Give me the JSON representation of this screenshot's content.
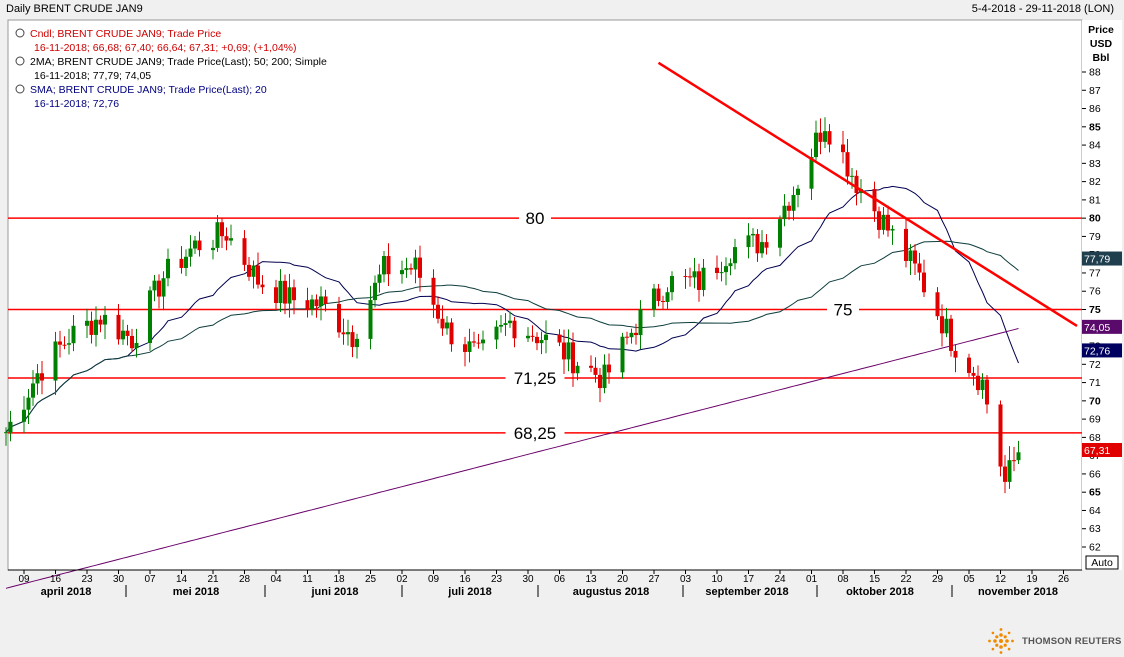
{
  "header": {
    "title": "Daily BRENT CRUDE JAN9",
    "range": "5-4-2018 - 29-11-2018 (LON)"
  },
  "axis_units": [
    "Price",
    "USD",
    "Bbl"
  ],
  "auto_label": "Auto",
  "legend": [
    {
      "line1": "Cndl; BRENT CRUDE JAN9; Trade Price",
      "line2": "16-11-2018; 66,68; 67,40; 66,64; 67,31; +0,69; (+1,04%)",
      "color": "#d00000"
    },
    {
      "line1": "2MA; BRENT CRUDE JAN9; Trade Price(Last); 50; 200; Simple",
      "line2": "16-11-2018; 77,79; 74,05",
      "color": "#000000"
    },
    {
      "line1": "SMA; BRENT CRUDE JAN9; Trade Price(Last); 20",
      "line2": "16-11-2018; 72,76",
      "color": "#000080"
    }
  ],
  "brand": "THOMSON REUTERS",
  "colors": {
    "up": "#008000",
    "down": "#e00000",
    "level": "#ff0000",
    "ma50": "#0d3d3d",
    "ma200": "#6a006a",
    "sma20": "#000050"
  },
  "chart_data": {
    "type": "candlestick",
    "y_range": [
      61,
      89
    ],
    "y_ticks": [
      62,
      63,
      64,
      65,
      66,
      67,
      68,
      69,
      70,
      71,
      72,
      73,
      74,
      75,
      76,
      77,
      78,
      79,
      80,
      81,
      82,
      83,
      84,
      85,
      86,
      87,
      88
    ],
    "y_bold_ticks": [
      65,
      70,
      75,
      80,
      85
    ],
    "x_day_ticks": [
      "09",
      "16",
      "23",
      "30",
      "07",
      "14",
      "21",
      "28",
      "04",
      "11",
      "18",
      "25",
      "02",
      "09",
      "16",
      "23",
      "30",
      "06",
      "13",
      "20",
      "27",
      "03",
      "10",
      "17",
      "24",
      "01",
      "08",
      "15",
      "22",
      "29",
      "05",
      "12",
      "19",
      "26"
    ],
    "months": [
      "april 2018",
      "mei 2018",
      "juni 2018",
      "juli 2018",
      "augustus 2018",
      "september 2018",
      "oktober 2018",
      "november 2018"
    ],
    "levels": [
      {
        "value": 80,
        "label": "80"
      },
      {
        "value": 75,
        "label": "75"
      },
      {
        "value": 71.25,
        "label": "71,25"
      },
      {
        "value": 68.25,
        "label": "68,25"
      }
    ],
    "trendline": {
      "start": [
        "2018-08-28",
        88.5
      ],
      "end": [
        "2018-11-29",
        74.1
      ]
    },
    "last_values": [
      {
        "label": "77,79",
        "value": 77.79,
        "series": "50"
      },
      {
        "label": "74,05",
        "value": 74.05,
        "series": "200"
      },
      {
        "label": "72,76",
        "value": 72.76,
        "series": "20"
      },
      {
        "label": "67,31",
        "value": 67.31,
        "series": "Cndl"
      }
    ],
    "closes_weekly": [
      [
        "2018-04-05",
        68.3
      ],
      [
        "2018-04-12",
        71.5
      ],
      [
        "2018-04-19",
        73.5
      ],
      [
        "2018-04-26",
        74.6
      ],
      [
        "2018-05-03",
        73.4
      ],
      [
        "2018-05-10",
        76.8
      ],
      [
        "2018-05-17",
        78.5
      ],
      [
        "2018-05-24",
        79.2
      ],
      [
        "2018-05-31",
        76.6
      ],
      [
        "2018-06-07",
        75.6
      ],
      [
        "2018-06-14",
        75.3
      ],
      [
        "2018-06-21",
        73.6
      ],
      [
        "2018-06-28",
        77.2
      ],
      [
        "2018-07-05",
        77.3
      ],
      [
        "2018-07-12",
        73.9
      ],
      [
        "2018-07-19",
        72.4
      ],
      [
        "2018-07-26",
        74.3
      ],
      [
        "2018-08-02",
        73.5
      ],
      [
        "2018-08-09",
        72.3
      ],
      [
        "2018-08-16",
        71.2
      ],
      [
        "2018-08-23",
        74.2
      ],
      [
        "2018-08-30",
        76.5
      ],
      [
        "2018-09-06",
        76.5
      ],
      [
        "2018-09-13",
        78.3
      ],
      [
        "2018-09-20",
        78.7
      ],
      [
        "2018-09-27",
        81.5
      ],
      [
        "2018-10-04",
        85.3
      ],
      [
        "2018-10-11",
        82.0
      ],
      [
        "2018-10-18",
        79.4
      ],
      [
        "2018-10-25",
        76.8
      ],
      [
        "2018-11-01",
        73.4
      ],
      [
        "2018-11-08",
        71.0
      ],
      [
        "2018-11-13",
        65.5
      ],
      [
        "2018-11-16",
        67.31
      ]
    ]
  }
}
